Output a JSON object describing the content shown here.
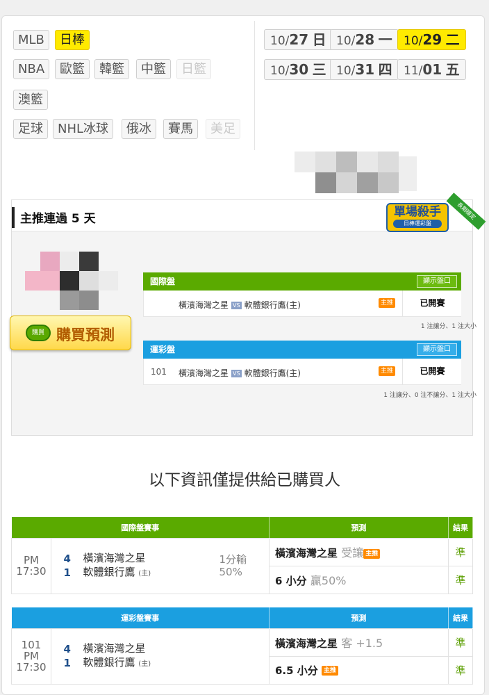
{
  "sports_tabs": {
    "row1": [
      {
        "label": "MLB",
        "state": "normal"
      },
      {
        "label": "日棒",
        "state": "active"
      }
    ],
    "row2": [
      {
        "label": "NBA",
        "state": "normal"
      },
      {
        "label": "歐籃",
        "state": "normal"
      },
      {
        "label": "韓籃",
        "state": "normal"
      },
      {
        "label": "中籃",
        "state": "normal"
      },
      {
        "label": "日籃",
        "state": "disabled"
      }
    ],
    "row3": [
      {
        "label": "澳籃",
        "state": "normal"
      }
    ],
    "row4": [
      {
        "label": "足球",
        "state": "normal"
      },
      {
        "label": "NHL冰球",
        "state": "normal"
      },
      {
        "label": "俄冰",
        "state": "normal"
      },
      {
        "label": "賽馬",
        "state": "normal"
      },
      {
        "label": "美足",
        "state": "disabled"
      }
    ]
  },
  "dates": [
    {
      "month": "10/",
      "day": "27",
      "weekday": "日",
      "active": false
    },
    {
      "month": "10/",
      "day": "28",
      "weekday": "一",
      "active": false
    },
    {
      "month": "10/",
      "day": "29",
      "weekday": "二",
      "active": true
    },
    {
      "month": "10/",
      "day": "30",
      "weekday": "三",
      "active": false
    },
    {
      "month": "10/",
      "day": "31",
      "weekday": "四",
      "active": false
    },
    {
      "month": "11/",
      "day": "01",
      "weekday": "五",
      "active": false
    }
  ],
  "panel": {
    "title": "主推連過 5 天",
    "badge_title": "單場殺手",
    "badge_sub": "日棒運彩盤",
    "ribbon": "長期穩定",
    "buy_icon": "購買",
    "buy_label": "購買預測"
  },
  "intl_market": {
    "title": "國際盤",
    "show_button": "顯示盤口",
    "num": "",
    "away": "橫濱海灣之星",
    "vs": "VS",
    "home": "軟體銀行鷹(主)",
    "tag": "主推",
    "status": "已開賽",
    "note": "1 注讓分、1 注大小"
  },
  "sport_market": {
    "title": "運彩盤",
    "show_button": "顯示盤口",
    "num": "101",
    "away": "橫濱海灣之星",
    "vs": "VS",
    "home": "軟體銀行鷹(主)",
    "tag": "主推",
    "status": "已開賽",
    "note": "1 注讓分、0 注不讓分、1 注大小"
  },
  "info_text": "以下資訊僅提供給已購買人",
  "intl_table": {
    "headers": {
      "event": "國際盤賽事",
      "pred": "預測",
      "result": "結果"
    },
    "time": "PM 17:30",
    "num": "",
    "away_score": "4",
    "home_score": "1",
    "away": "橫濱海灣之星",
    "home": "軟體銀行鷹",
    "home_mark": "(主)",
    "odds_line1": "1分輸",
    "odds_line2": "50%",
    "pred1_main": "橫濱海灣之星",
    "pred1_sub": "受讓",
    "pred1_tag": "主推",
    "pred2_main": "6 小分",
    "pred2_sub": "贏50%",
    "pred2_tag": "",
    "result1": "準",
    "result2": "準"
  },
  "sport_table": {
    "headers": {
      "event": "運彩盤賽事",
      "pred": "預測",
      "result": "結果"
    },
    "time": "PM 17:30",
    "num": "101",
    "away_score": "4",
    "home_score": "1",
    "away": "橫濱海灣之星",
    "home": "軟體銀行鷹",
    "home_mark": "(主)",
    "odds_line1": "",
    "odds_line2": "",
    "pred1_main": "橫濱海灣之星",
    "pred1_sub": "客 +1.5",
    "pred1_tag": "",
    "pred2_main": "6.5 小分",
    "pred2_sub": "",
    "pred2_tag": "主推",
    "result1": "準",
    "result2": "準"
  },
  "colors": {
    "accent_yellow": "#ffea00",
    "green": "#5aaa00",
    "blue": "#1b9fe0",
    "tag_orange": "#ff8a00"
  }
}
